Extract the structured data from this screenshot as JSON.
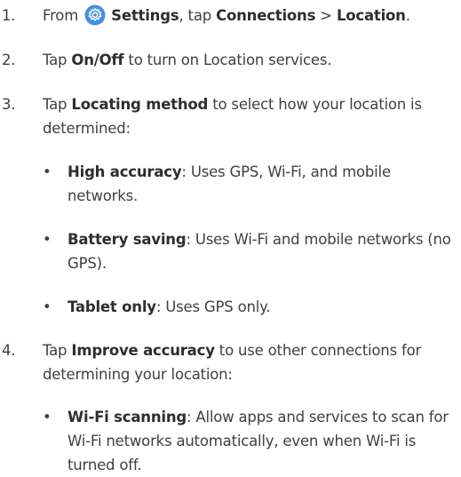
{
  "steps": [
    {
      "num": "1.",
      "parts": [
        "From ",
        "Settings",
        ", tap ",
        "Connections",
        " > ",
        "Location",
        "."
      ]
    },
    {
      "num": "2.",
      "parts": [
        "Tap ",
        "On/Off",
        " to turn on Location services."
      ]
    },
    {
      "num": "3.",
      "parts": [
        "Tap ",
        "Locating method",
        " to select how your location is determined:"
      ]
    },
    {
      "num": "4.",
      "parts": [
        "Tap ",
        "Improve accuracy",
        " to use other connections for determining your location:"
      ]
    }
  ],
  "bullets_step3": [
    {
      "term": "High accuracy",
      "desc": ": Uses GPS, Wi-Fi, and mobile networks."
    },
    {
      "term": "Battery saving",
      "desc": ": Uses Wi-Fi and mobile networks (no GPS)."
    },
    {
      "term": "Tablet only",
      "desc": ": Uses GPS only."
    }
  ],
  "bullets_step4": [
    {
      "term": "Wi-Fi scanning",
      "desc": ": Allow apps and services to scan for Wi-Fi networks automatically, even when Wi-Fi is turned off."
    }
  ],
  "bullet_char": "•",
  "icons": {
    "settings": "settings-gear-icon"
  },
  "colors": {
    "settings_icon": "#4a8fe0",
    "text": "#404040"
  }
}
